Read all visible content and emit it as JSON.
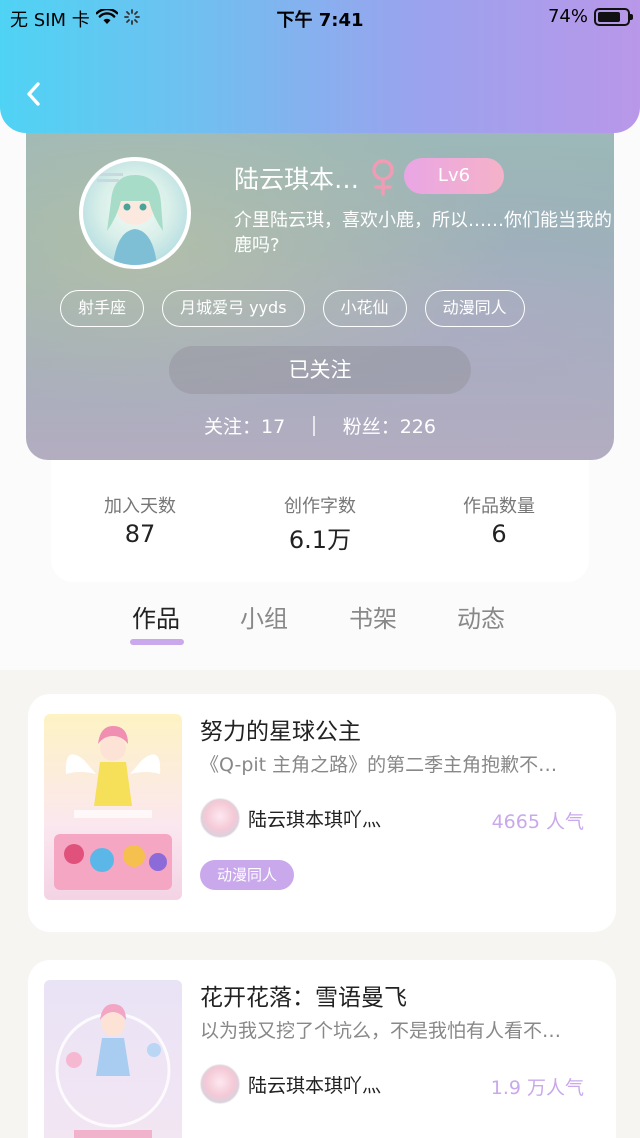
{
  "status_bar": {
    "carrier": "无 SIM 卡",
    "time": "下午 7:41",
    "battery": "74%"
  },
  "profile": {
    "nickname": "陆云琪本…",
    "level": "Lv6",
    "bio": "介里陆云琪，喜欢小鹿，所以……你们能当我的\n鹿吗?",
    "tags": [
      "射手座",
      "月城爱弓 yyds",
      "小花仙",
      "动漫同人"
    ],
    "follow_button": "已关注",
    "following_label": "关注：17",
    "followers_label": "粉丝：226"
  },
  "stats": [
    {
      "label": "加入天数",
      "value": "87"
    },
    {
      "label": "创作字数",
      "value": "6.1万"
    },
    {
      "label": "作品数量",
      "value": "6"
    }
  ],
  "tabs": [
    "作品",
    "小组",
    "书架",
    "动态"
  ],
  "active_tab": "作品",
  "works": [
    {
      "title": "努力的星球公主",
      "description": "《Q-pit 主角之路》的第二季主角抱歉不…",
      "author": "陆云琪本琪吖灬",
      "popularity": "4665 人气",
      "tag": "动漫同人"
    },
    {
      "title": "花开花落：雪语曼飞",
      "description": "以为我又挖了个坑么，不是我怕有人看不…",
      "author": "陆云琪本琪吖灬",
      "popularity": "1.9 万人气"
    }
  ],
  "colors": {
    "accent": "#c9a8ec",
    "header_gradient_start": "#4fd3f4",
    "header_gradient_end": "#b997e9"
  },
  "icons": [
    "back-arrow-icon",
    "wifi-icon",
    "loading-icon",
    "battery-icon",
    "female-icon"
  ]
}
